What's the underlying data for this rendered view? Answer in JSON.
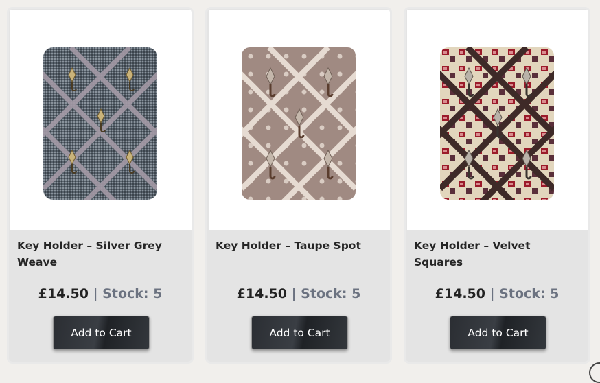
{
  "products": [
    {
      "title": "Key Holder – Silver Grey Weave",
      "price": "£14.50",
      "separator": " | ",
      "stock": "Stock: 5",
      "button_label": "Add to Cart",
      "image_icon": "key-holder-silver-grey-weave-image"
    },
    {
      "title": "Key Holder – Taupe Spot",
      "price": "£14.50",
      "separator": " | ",
      "stock": "Stock: 5",
      "button_label": "Add to Cart",
      "image_icon": "key-holder-taupe-spot-image"
    },
    {
      "title": "Key Holder – Velvet Squares",
      "price": "£14.50",
      "separator": " | ",
      "stock": "Stock: 5",
      "button_label": "Add to Cart",
      "image_icon": "key-holder-velvet-squares-image"
    }
  ],
  "colors": {
    "button_bg": "#2f3237",
    "stock_text": "#6b7280",
    "card_bg": "#e4e4e4"
  }
}
